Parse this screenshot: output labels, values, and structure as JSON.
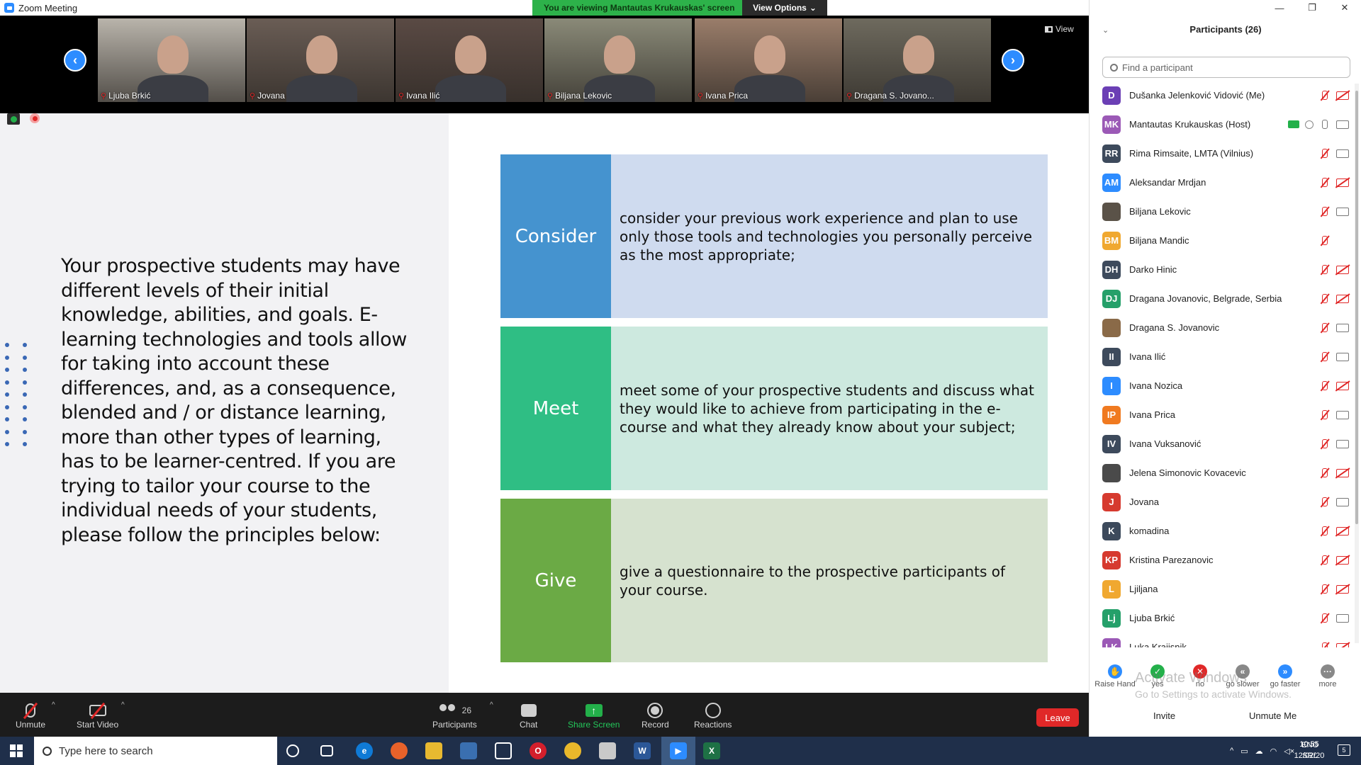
{
  "window": {
    "title": "Zoom Meeting",
    "viewing_banner": "You are viewing Mantautas Krukauskas' screen",
    "view_options": "View Options",
    "view_label": "View"
  },
  "thumbnails": [
    {
      "name": "Ljuba Brkić",
      "bg": "#b9b4ab"
    },
    {
      "name": "Jovana",
      "bg": "#6a5d55"
    },
    {
      "name": "Ivana Ilić",
      "bg": "#5a4a44"
    },
    {
      "name": "Biljana Lekovic",
      "bg": "#8a8a78"
    },
    {
      "name": "Ivana Prica",
      "bg": "#9a7d6a"
    },
    {
      "name": "Dragana S. Jovano...",
      "bg": "#6e6a5e"
    }
  ],
  "slide": {
    "intro": "Your prospective students may have different levels of their initial knowledge, abilities, and goals. E-learning technologies and tools allow for taking into account these differences, and, as a consequence, blended and / or distance learning, more than other types of learning, has to be learner-centred. If you are trying to tailor your course to the individual needs of your students, please follow the principles below:",
    "rows": [
      {
        "label": "Consider",
        "text": "consider your previous work experience and plan to use only those tools and technologies you personally perceive as the most appropriate;"
      },
      {
        "label": "Meet",
        "text": "meet some of your prospective students and discuss what they would like to achieve from participating in the e-course and what they already know about your subject;"
      },
      {
        "label": "Give",
        "text": "give a questionnaire to the prospective participants of your course."
      }
    ]
  },
  "toolbar": {
    "unmute": "Unmute",
    "start_video": "Start Video",
    "participants": "Participants",
    "participants_count": "26",
    "chat": "Chat",
    "share_screen": "Share Screen",
    "record": "Record",
    "reactions": "Reactions",
    "leave": "Leave"
  },
  "panel": {
    "title": "Participants (26)",
    "search_placeholder": "Find a participant",
    "participants": [
      {
        "initials": "D",
        "name": "Dušanka Jelenković Vidović (Me)",
        "color": "#6b3fb5",
        "mic": "off",
        "cam": "off"
      },
      {
        "initials": "MK",
        "name": "Mantautas Krukauskas (Host)",
        "color": "#9b59b6",
        "mic": "on",
        "cam": "on",
        "sharing": true
      },
      {
        "initials": "RR",
        "name": " Rima Rimsaite, LMTA (Vilnius)",
        "color": "#3d4a5c",
        "mic": "off",
        "cam": "on"
      },
      {
        "initials": "AM",
        "name": "Aleksandar Mrdjan",
        "color": "#2D8CFF",
        "mic": "off",
        "cam": "off"
      },
      {
        "initials": "",
        "name": "Biljana Lekovic",
        "color": "#5a5248",
        "mic": "off",
        "cam": "on"
      },
      {
        "initials": "BM",
        "name": "Biljana Mandic",
        "color": "#f0a830",
        "mic": "off",
        "cam": "none"
      },
      {
        "initials": "DH",
        "name": "Darko Hinic",
        "color": "#3d4a5c",
        "mic": "off",
        "cam": "off"
      },
      {
        "initials": "DJ",
        "name": "Dragana Jovanovic, Belgrade, Serbia",
        "color": "#25a06a",
        "mic": "off",
        "cam": "off"
      },
      {
        "initials": "",
        "name": "Dragana S. Jovanovic",
        "color": "#8a6a48",
        "mic": "off",
        "cam": "on"
      },
      {
        "initials": "II",
        "name": "Ivana Ilić",
        "color": "#3d4a5c",
        "mic": "off",
        "cam": "on"
      },
      {
        "initials": "I",
        "name": "Ivana Nozica",
        "color": "#2D8CFF",
        "mic": "off",
        "cam": "off"
      },
      {
        "initials": "IP",
        "name": "Ivana Prica",
        "color": "#f07a20",
        "mic": "off",
        "cam": "on"
      },
      {
        "initials": "IV",
        "name": "Ivana Vuksanović",
        "color": "#3d4a5c",
        "mic": "off",
        "cam": "on"
      },
      {
        "initials": "",
        "name": "Jelena Simonovic Kovacevic",
        "color": "#4a4a4a",
        "mic": "off",
        "cam": "off"
      },
      {
        "initials": "J",
        "name": "Jovana",
        "color": "#d63a2f",
        "mic": "off",
        "cam": "on"
      },
      {
        "initials": "K",
        "name": "komadina",
        "color": "#3d4a5c",
        "mic": "off",
        "cam": "off"
      },
      {
        "initials": "KP",
        "name": "Kristina Parezanovic",
        "color": "#d63a2f",
        "mic": "off",
        "cam": "off"
      },
      {
        "initials": "L",
        "name": "Ljiljana",
        "color": "#f0a830",
        "mic": "off",
        "cam": "off"
      },
      {
        "initials": "Lj",
        "name": "Ljuba Brkić",
        "color": "#25a06a",
        "mic": "off",
        "cam": "on"
      },
      {
        "initials": "LK",
        "name": "Luka Krajisnik",
        "color": "#9b59b6",
        "mic": "off",
        "cam": "off"
      }
    ],
    "reactions": [
      {
        "label": "Raise Hand",
        "glyph": "✋",
        "color": "#2D8CFF"
      },
      {
        "label": "yes",
        "glyph": "✓",
        "color": "#23b04a"
      },
      {
        "label": "no",
        "glyph": "✕",
        "color": "#e02828"
      },
      {
        "label": "go slower",
        "glyph": "«",
        "color": "#888888"
      },
      {
        "label": "go faster",
        "glyph": "»",
        "color": "#2D8CFF"
      },
      {
        "label": "more",
        "glyph": "···",
        "color": "#888888"
      }
    ],
    "watermark_title": "Activate Windows",
    "watermark_sub": "Go to Settings to activate Windows.",
    "invite": "Invite",
    "unmute_me": "Unmute Me"
  },
  "taskbar": {
    "search_placeholder": "Type here to search",
    "language": "ENG",
    "layout": "SRL",
    "time": "10:55",
    "date": "12/02/20",
    "notifications": "5"
  }
}
